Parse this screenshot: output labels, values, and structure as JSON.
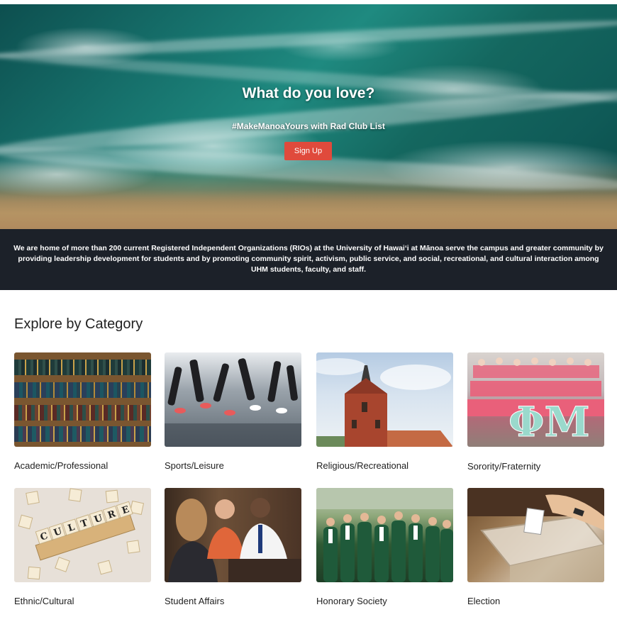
{
  "hero": {
    "title": "What do you love?",
    "subtitle": "#MakeManoaYours with Rad Club List",
    "signup_label": "Sign Up"
  },
  "info": {
    "text": "We are home of more than 200 current Registered Independent Organizations (RIOs) at the University of Hawaiʻi at Mānoa serve the campus and greater community by providing leadership development for students and by promoting community spirit, activism, public service, and social, recreational, and cultural interaction among UHM students, faculty, and staff."
  },
  "categories": {
    "title": "Explore by Category",
    "items": [
      {
        "label": "Academic/Professional"
      },
      {
        "label": "Sports/Leisure"
      },
      {
        "label": "Religious/Recreational"
      },
      {
        "label": "Sorority/Fraternity"
      },
      {
        "label": "Ethnic/Cultural"
      },
      {
        "label": "Student Affairs"
      },
      {
        "label": "Honorary Society"
      },
      {
        "label": "Election"
      }
    ]
  },
  "colors": {
    "accent": "#e04a3c",
    "info_band": "#1c2129"
  }
}
